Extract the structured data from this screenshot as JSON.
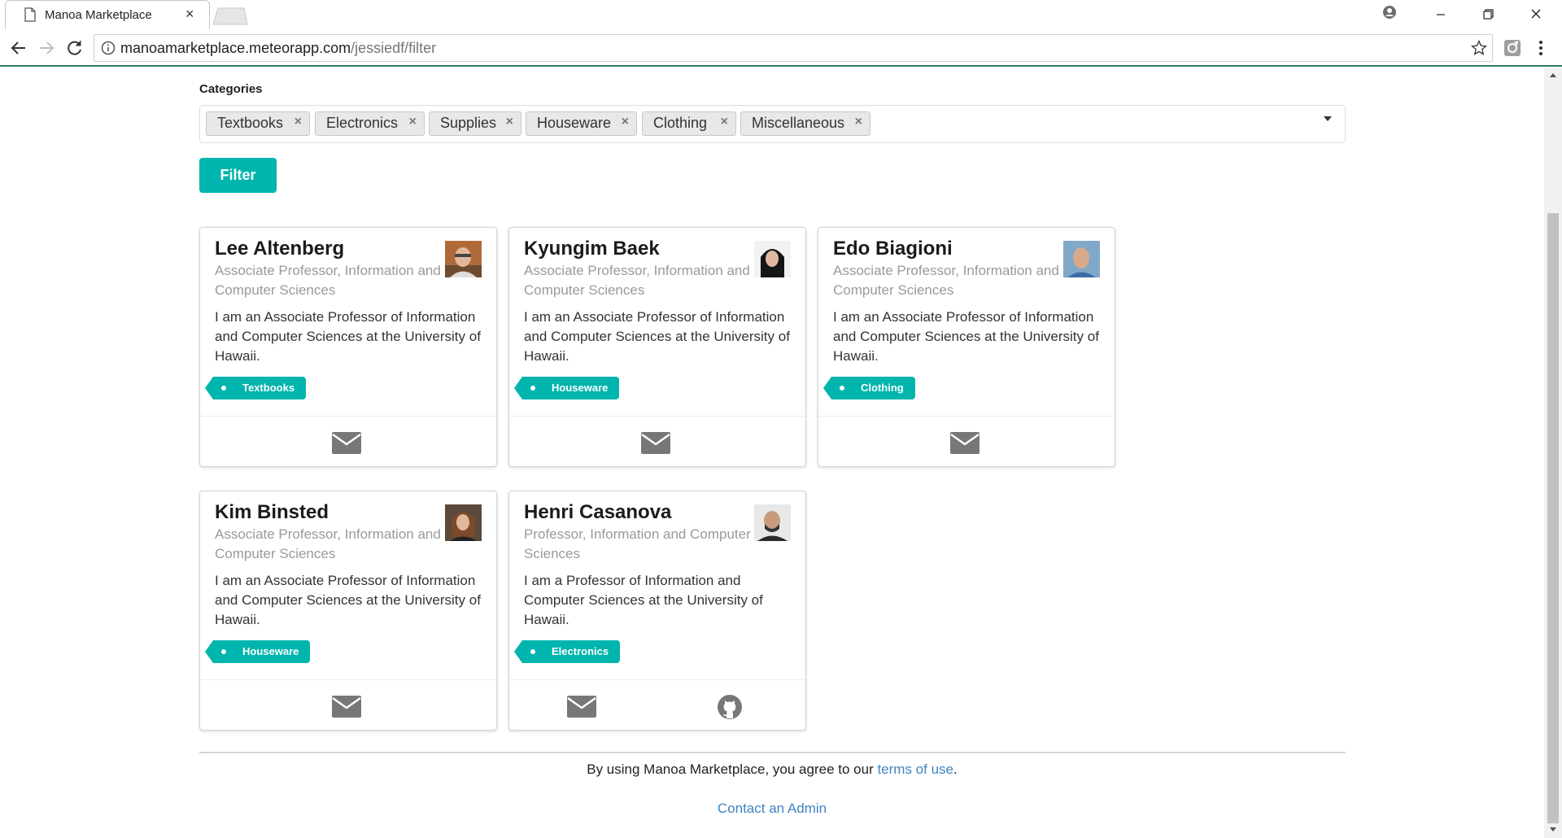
{
  "browser": {
    "tab_title": "Manoa Marketplace",
    "tab_close": "×",
    "url_host": "manoamarketplace.meteorapp.com",
    "url_path": "/jessiedf/filter"
  },
  "filter": {
    "label": "Categories",
    "selected": [
      "Textbooks",
      "Electronics",
      "Supplies",
      "Houseware",
      "Clothing",
      "Miscellaneous"
    ],
    "remove_glyph": "×",
    "button_label": "Filter"
  },
  "profiles": [
    {
      "name": "Lee Altenberg",
      "title": "Associate Professor, Information and Computer Sciences",
      "bio": "I am an Associate Professor of Information and Computer Sciences at the University of Hawaii.",
      "tag": "Textbooks",
      "icons": [
        "mail-icon"
      ]
    },
    {
      "name": "Kyungim Baek",
      "title": "Associate Professor, Information and Computer Sciences",
      "bio": "I am an Associate Professor of Information and Computer Sciences at the University of Hawaii.",
      "tag": "Houseware",
      "icons": [
        "mail-icon"
      ]
    },
    {
      "name": "Edo Biagioni",
      "title": "Associate Professor, Information and Computer Sciences",
      "bio": "I am an Associate Professor of Information and Computer Sciences at the University of Hawaii.",
      "tag": "Clothing",
      "icons": [
        "mail-icon"
      ]
    },
    {
      "name": "Kim Binsted",
      "title": "Associate Professor, Information and Computer Sciences",
      "bio": "I am an Associate Professor of Information and Computer Sciences at the University of Hawaii.",
      "tag": "Houseware",
      "icons": [
        "mail-icon"
      ]
    },
    {
      "name": "Henri Casanova",
      "title": "Professor, Information and Computer Sciences",
      "bio": "I am a Professor of Information and Computer Sciences at the University of Hawaii.",
      "tag": "Electronics",
      "icons": [
        "mail-icon",
        "github-icon"
      ]
    }
  ],
  "footer": {
    "terms_prefix": "By using Manoa Marketplace, you agree to our ",
    "terms_link": "terms of use",
    "terms_suffix": ".",
    "contact": "Contact an Admin"
  },
  "colors": {
    "accent": "#00b5ad",
    "link": "#4183c4"
  }
}
